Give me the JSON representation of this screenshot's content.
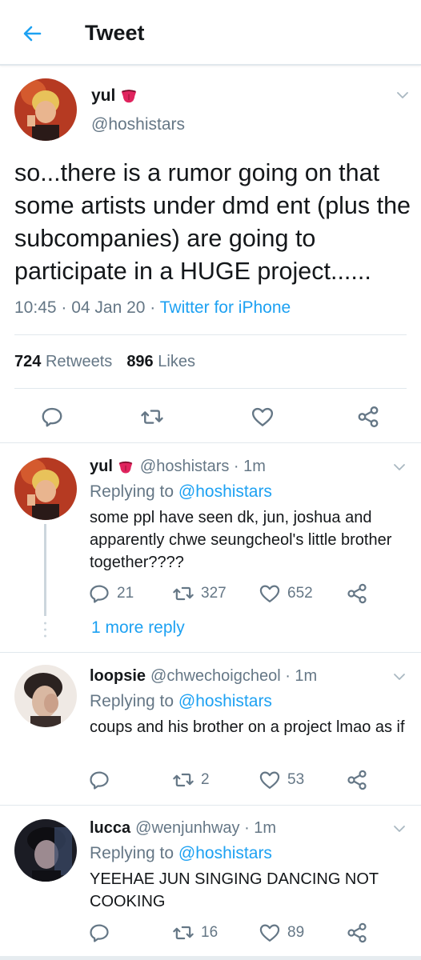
{
  "header": {
    "title": "Tweet"
  },
  "main_tweet": {
    "name": "yul",
    "handle": "@hoshistars",
    "text": "so...there is a rumor going on that some artists under dmd ent (plus the subcompanies) are going to participate in a HUGE project......",
    "time": "10:45 · 04 Jan 20 ·",
    "source": "Twitter for iPhone",
    "retweets_count": "724",
    "retweets_label": "Retweets",
    "likes_count": "896",
    "likes_label": "Likes"
  },
  "replies": [
    {
      "name": "yul",
      "handle": "@hoshistars · 1m",
      "replying_prefix": "Replying to",
      "replying_to": "@hoshistars",
      "text": "some ppl have seen dk, jun, joshua and apparently chwe seungcheol's little brother together????",
      "reply_count": "21",
      "retweet_count": "327",
      "like_count": "652",
      "more_replies": "1 more reply"
    },
    {
      "name": "loopsie",
      "handle": "@chwechoigcheol · 1m",
      "replying_prefix": "Replying to",
      "replying_to": "@hoshistars",
      "text": "coups and his brother on a project lmao as if",
      "reply_count": "",
      "retweet_count": "2",
      "like_count": "53"
    },
    {
      "name": "lucca",
      "handle": "@wenjunhway · 1m",
      "replying_prefix": "Replying to",
      "replying_to": "@hoshistars",
      "text": "YEEHAE JUN SINGING DANCING NOT COOKING",
      "reply_count": "",
      "retweet_count": "16",
      "like_count": "89"
    }
  ],
  "colors": {
    "accent": "#1da1f2",
    "text": "#14171a",
    "secondary": "#657786",
    "divider": "#e1e8ed",
    "emoji": "#e0245e"
  }
}
